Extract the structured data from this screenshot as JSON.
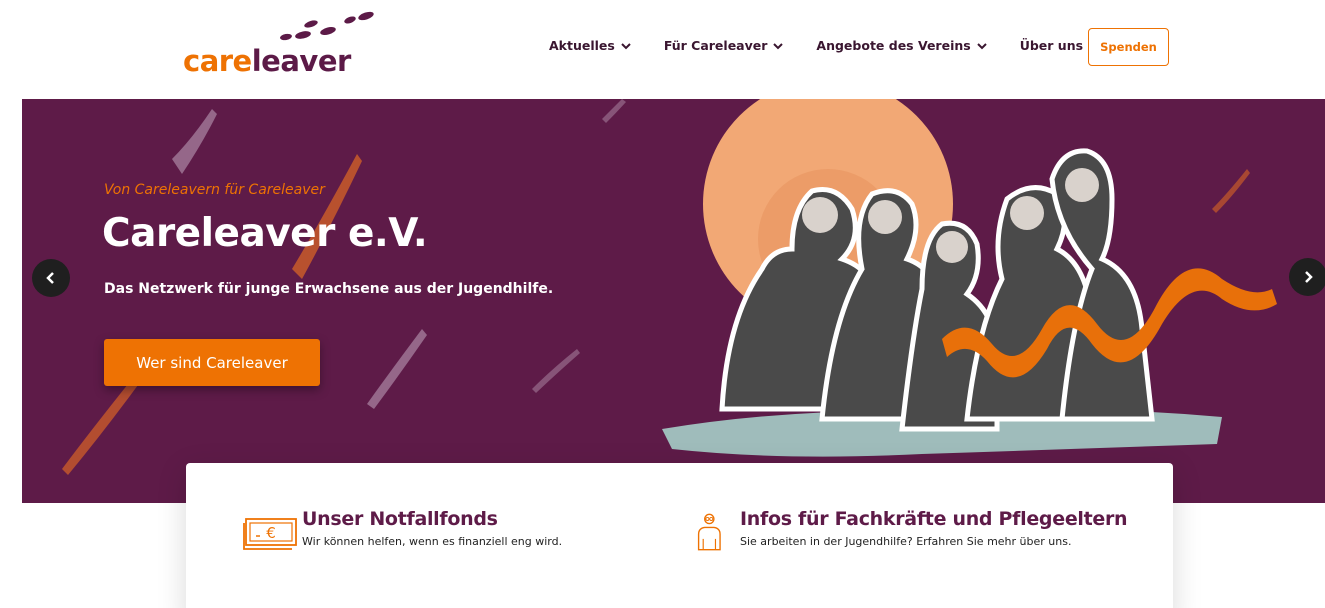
{
  "header": {
    "logo": {
      "part1": "care",
      "part2": "leaver"
    },
    "nav": [
      {
        "label": "Aktuelles"
      },
      {
        "label": "Für Careleaver"
      },
      {
        "label": "Angebote des Vereins"
      },
      {
        "label": "Über uns"
      }
    ],
    "donate_label": "Spenden"
  },
  "hero": {
    "subtitle": "Von Careleavern für Careleaver",
    "title": "Careleaver e.V.",
    "text": "Das Netzwerk für junge Erwachsene aus der Jugendhilfe.",
    "button_label": "Wer sind Careleaver",
    "prev_label": "‹",
    "next_label": "›",
    "background_color": "#5e1b48",
    "accent_color": "#ee7203"
  },
  "features": [
    {
      "icon": "money-euro-icon",
      "title": "Unser Notfallfonds",
      "text": "Wir können helfen, wenn es finanziell eng wird."
    },
    {
      "icon": "person-professional-icon",
      "title": "Infos für Fachkräfte und Pflegeeltern",
      "text": "Sie arbeiten in der Jugendhilfe? Erfahren Sie mehr über uns."
    }
  ]
}
